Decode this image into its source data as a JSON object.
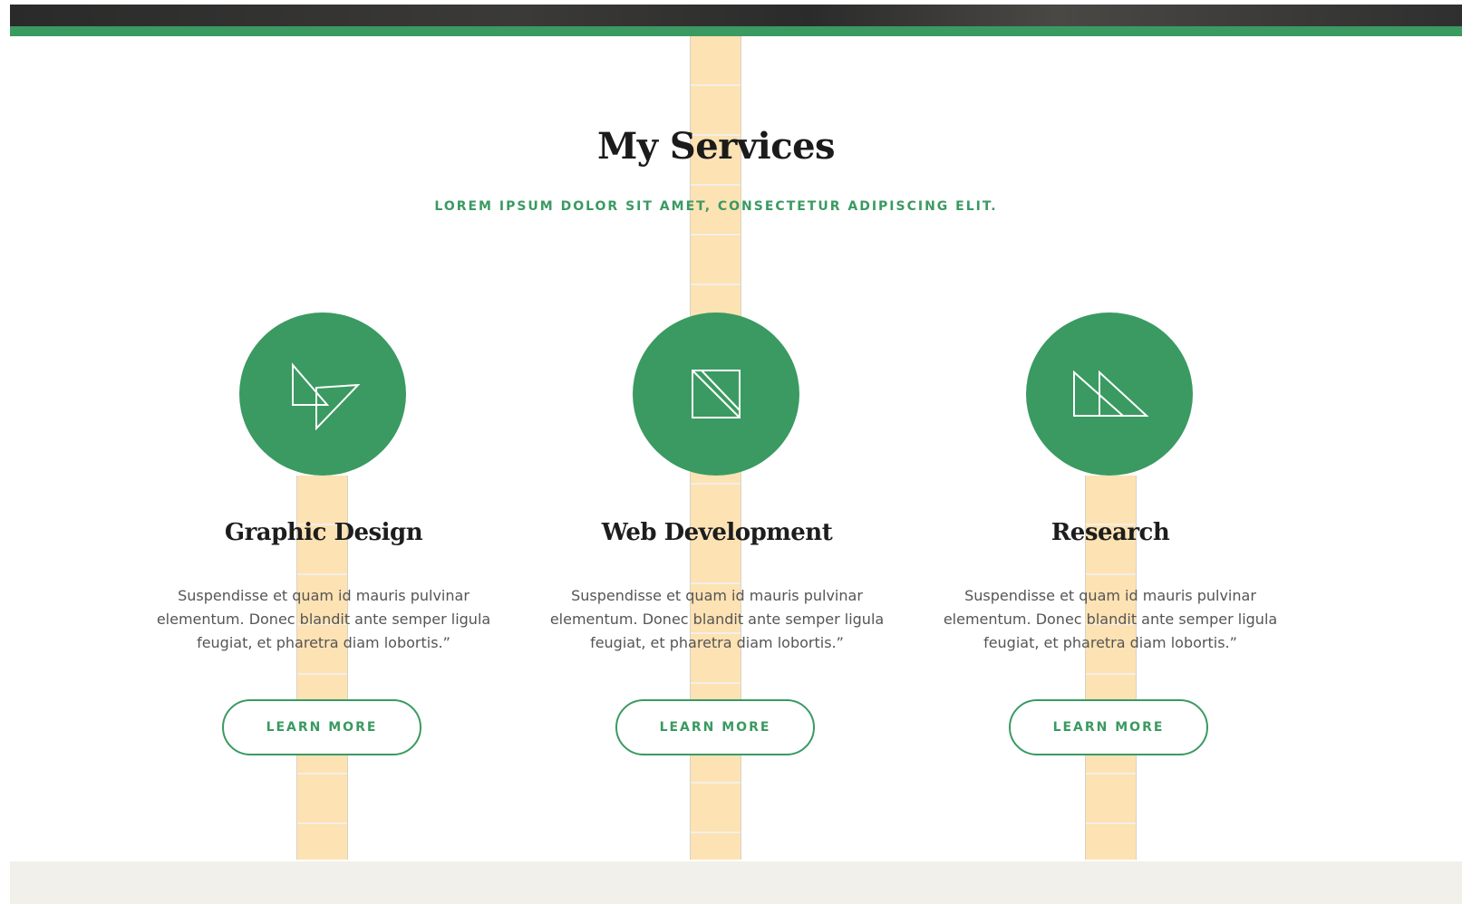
{
  "section": {
    "title": "My Services",
    "subtitle": "LOREM IPSUM DOLOR SIT AMET, CONSECTETUR ADIPISCING ELIT."
  },
  "services": [
    {
      "title": "Graphic Design",
      "text": "Suspendisse et quam id mauris pulvinar elementum. Donec blandit ante semper ligula feugiat, et pharetra diam lobortis.”",
      "button": "LEARN MORE",
      "icon": "overlapping-triangles-icon"
    },
    {
      "title": "Web Development",
      "text": "Suspendisse et quam id mauris pulvinar elementum. Donec blandit ante semper ligula feugiat, et pharetra diam lobortis.”",
      "button": "LEARN MORE",
      "icon": "split-square-icon"
    },
    {
      "title": "Research",
      "text": "Suspendisse et quam id mauris pulvinar elementum. Donec blandit ante semper ligula feugiat, et pharetra diam lobortis.”",
      "button": "LEARN MORE",
      "icon": "double-triangle-icon"
    }
  ],
  "colors": {
    "accent": "#3a9a61",
    "guide": "#fde2b3",
    "footer": "#f2f0ea",
    "heading": "#1b1b1b",
    "body_text": "#555555"
  }
}
